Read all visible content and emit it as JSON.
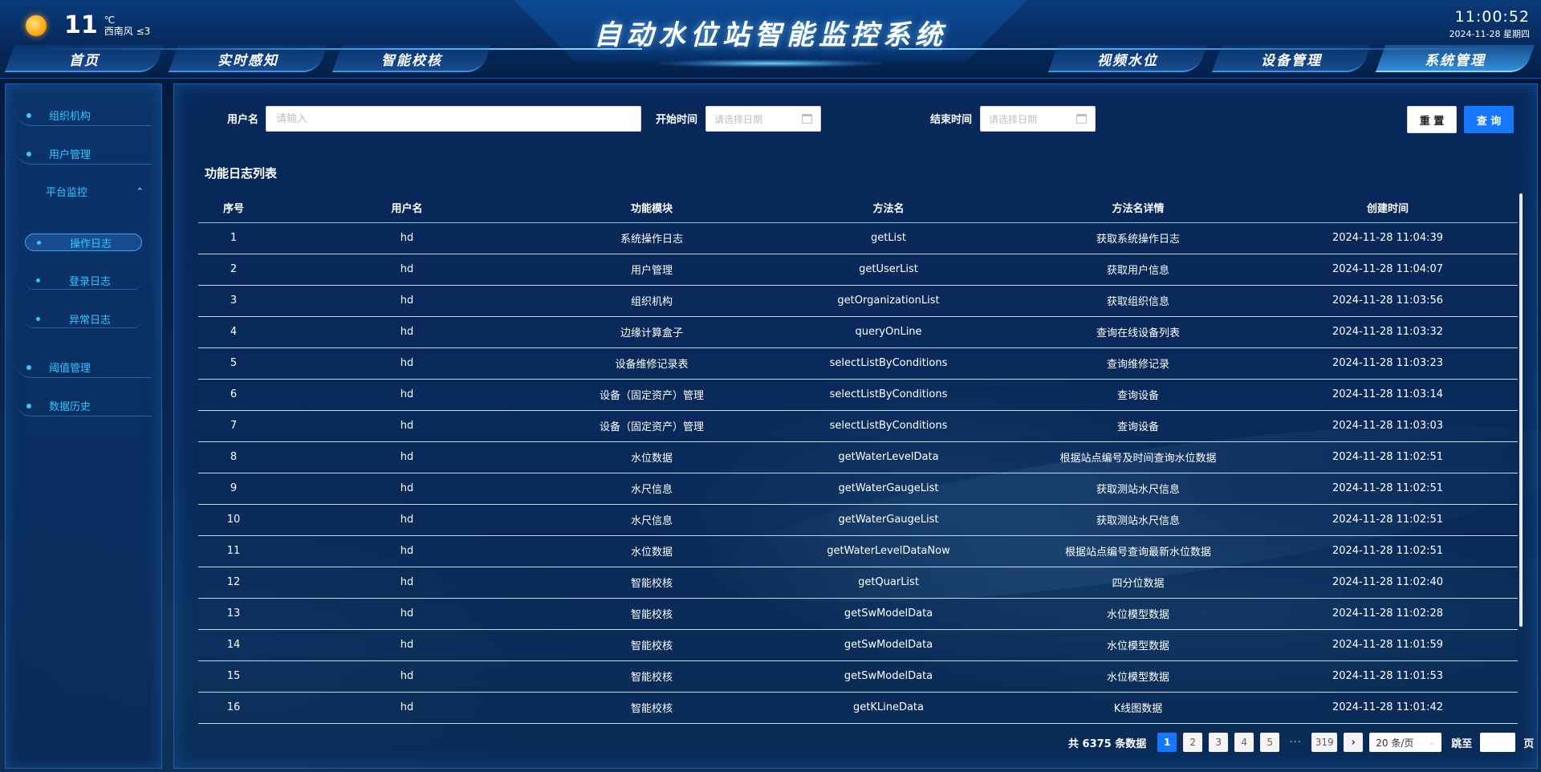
{
  "header": {
    "title": "自动水位站智能监控系统",
    "weather": {
      "temperature": "11",
      "unit": "℃",
      "wind": "西南风 ≤3"
    },
    "clock": {
      "time": "11:00:52",
      "date": "2024-11-28 星期四"
    },
    "nav_left": [
      "首页",
      "实时感知",
      "智能校核"
    ],
    "nav_right": [
      "视频水位",
      "设备管理",
      "系统管理"
    ],
    "active_nav": "系统管理"
  },
  "sidebar": {
    "items": [
      "组织机构",
      "用户管理"
    ],
    "group": {
      "label": "平台监控",
      "expanded": true,
      "children": [
        "操作日志",
        "登录日志",
        "异常日志"
      ],
      "active_child": "操作日志"
    },
    "items_after": [
      "阈值管理",
      "数据历史"
    ]
  },
  "filters": {
    "username_label": "用户名",
    "username_placeholder": "请输入",
    "start_label": "开始时间",
    "start_placeholder": "请选择日期",
    "end_label": "结束时间",
    "end_placeholder": "请选择日期",
    "reset_label": "重 置",
    "query_label": "查 询"
  },
  "table": {
    "title": "功能日志列表",
    "columns": [
      "序号",
      "用户名",
      "功能模块",
      "方法名",
      "方法名详情",
      "创建时间"
    ],
    "rows": [
      [
        "1",
        "hd",
        "系统操作日志",
        "getList",
        "获取系统操作日志",
        "2024-11-28 11:04:39"
      ],
      [
        "2",
        "hd",
        "用户管理",
        "getUserList",
        "获取用户信息",
        "2024-11-28 11:04:07"
      ],
      [
        "3",
        "hd",
        "组织机构",
        "getOrganizationList",
        "获取组织信息",
        "2024-11-28 11:03:56"
      ],
      [
        "4",
        "hd",
        "边缘计算盒子",
        "queryOnLine",
        "查询在线设备列表",
        "2024-11-28 11:03:32"
      ],
      [
        "5",
        "hd",
        "设备维修记录表",
        "selectListByConditions",
        "查询维修记录",
        "2024-11-28 11:03:23"
      ],
      [
        "6",
        "hd",
        "设备（固定资产）管理",
        "selectListByConditions",
        "查询设备",
        "2024-11-28 11:03:14"
      ],
      [
        "7",
        "hd",
        "设备（固定资产）管理",
        "selectListByConditions",
        "查询设备",
        "2024-11-28 11:03:03"
      ],
      [
        "8",
        "hd",
        "水位数据",
        "getWaterLevelData",
        "根据站点编号及时间查询水位数据",
        "2024-11-28 11:02:51"
      ],
      [
        "9",
        "hd",
        "水尺信息",
        "getWaterGaugeList",
        "获取测站水尺信息",
        "2024-11-28 11:02:51"
      ],
      [
        "10",
        "hd",
        "水尺信息",
        "getWaterGaugeList",
        "获取测站水尺信息",
        "2024-11-28 11:02:51"
      ],
      [
        "11",
        "hd",
        "水位数据",
        "getWaterLevelDataNow",
        "根据站点编号查询最新水位数据",
        "2024-11-28 11:02:51"
      ],
      [
        "12",
        "hd",
        "智能校核",
        "getQuarList",
        "四分位数据",
        "2024-11-28 11:02:40"
      ],
      [
        "13",
        "hd",
        "智能校核",
        "getSwModelData",
        "水位模型数据",
        "2024-11-28 11:02:28"
      ],
      [
        "14",
        "hd",
        "智能校核",
        "getSwModelData",
        "水位模型数据",
        "2024-11-28 11:01:59"
      ],
      [
        "15",
        "hd",
        "智能校核",
        "getSwModelData",
        "水位模型数据",
        "2024-11-28 11:01:53"
      ],
      [
        "16",
        "hd",
        "智能校核",
        "getKLineData",
        "K线图数据",
        "2024-11-28 11:01:42"
      ]
    ]
  },
  "pagination": {
    "total_text": "共 6375 条数据",
    "pages": [
      "1",
      "2",
      "3",
      "4",
      "5"
    ],
    "active_page": "1",
    "ellipsis": "···",
    "last_page": "319",
    "next": "›",
    "page_size": "20 条/页",
    "jump_label": "跳至",
    "jump_suffix": "页"
  },
  "colors": {
    "accent": "#1677ff",
    "sidebar_text": "#33c6ff",
    "panel_border": "#1f5ba6"
  }
}
